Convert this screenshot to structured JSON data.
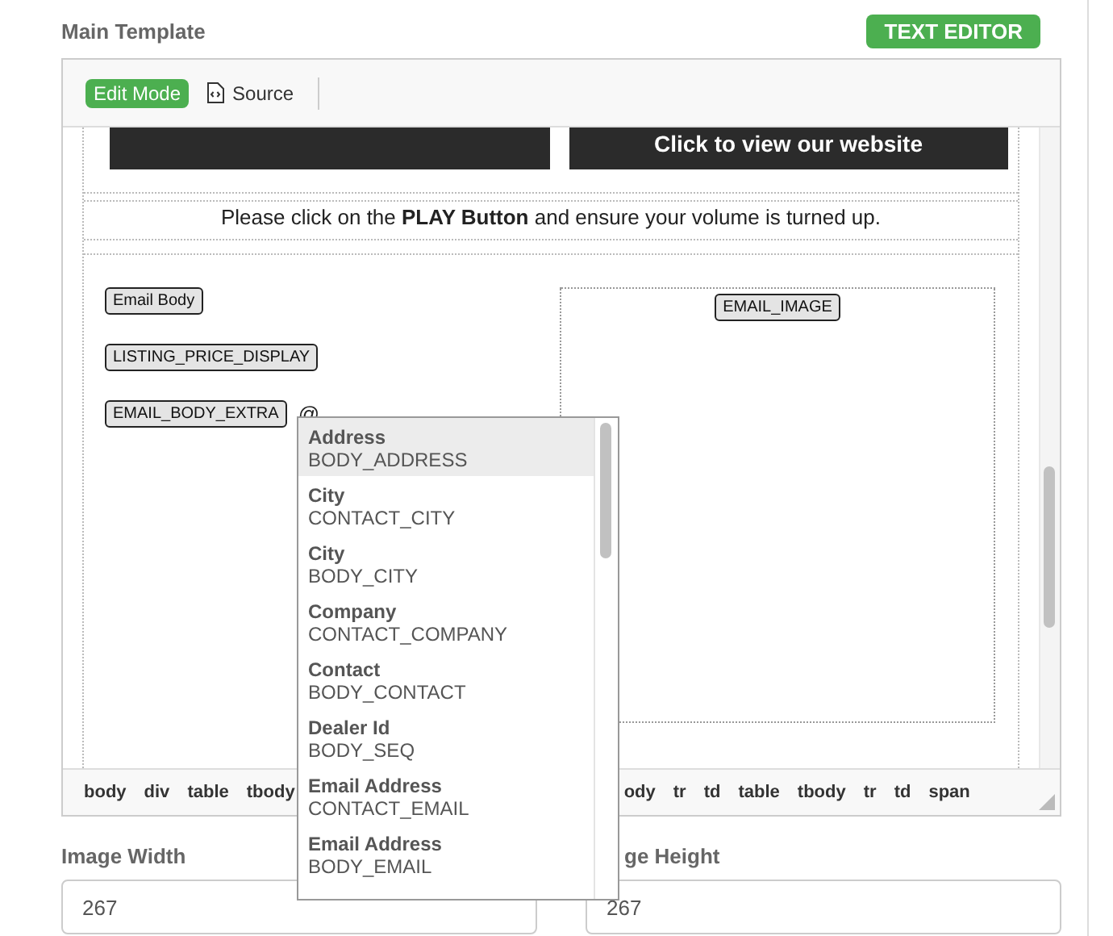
{
  "header": {
    "title": "Main Template",
    "mode_button": "TEXT EDITOR"
  },
  "toolbar": [
    {
      "kind": "pill",
      "label": "Edit Mode",
      "selected": true
    },
    {
      "kind": "source",
      "label": "Source",
      "selected": false
    }
  ],
  "content": {
    "banner_link": "Click to view our website",
    "message": "Please click on the **PLAY Button** and ensure your volume is turned up.",
    "tokens": [
      "Email Body",
      "LISTING_PRICE_DISPLAY",
      "EMAIL_BODY_EXTRA"
    ],
    "trigger": "@",
    "image_token": "EMAIL_IMAGE"
  },
  "mention_menu": [
    {
      "label": "Address",
      "code": "BODY_ADDRESS",
      "selected": true
    },
    {
      "label": "City",
      "code": "CONTACT_CITY",
      "selected": false
    },
    {
      "label": "City",
      "code": "BODY_CITY",
      "selected": false
    },
    {
      "label": "Company",
      "code": "CONTACT_COMPANY",
      "selected": false
    },
    {
      "label": "Contact",
      "code": "BODY_CONTACT",
      "selected": false
    },
    {
      "label": "Dealer Id",
      "code": "BODY_SEQ",
      "selected": false
    },
    {
      "label": "Email Address",
      "code": "CONTACT_EMAIL",
      "selected": false
    },
    {
      "label": "Email Address",
      "code": "BODY_EMAIL",
      "selected": false
    }
  ],
  "path_bar": {
    "left": [
      "body",
      "div",
      "table",
      "tbody"
    ],
    "right": [
      "ody",
      "tr",
      "td",
      "table",
      "tbody",
      "tr",
      "td",
      "span"
    ]
  },
  "fields": [
    {
      "label": "Image Width",
      "value": "267"
    },
    {
      "label": "ge Height",
      "value": "267"
    }
  ]
}
